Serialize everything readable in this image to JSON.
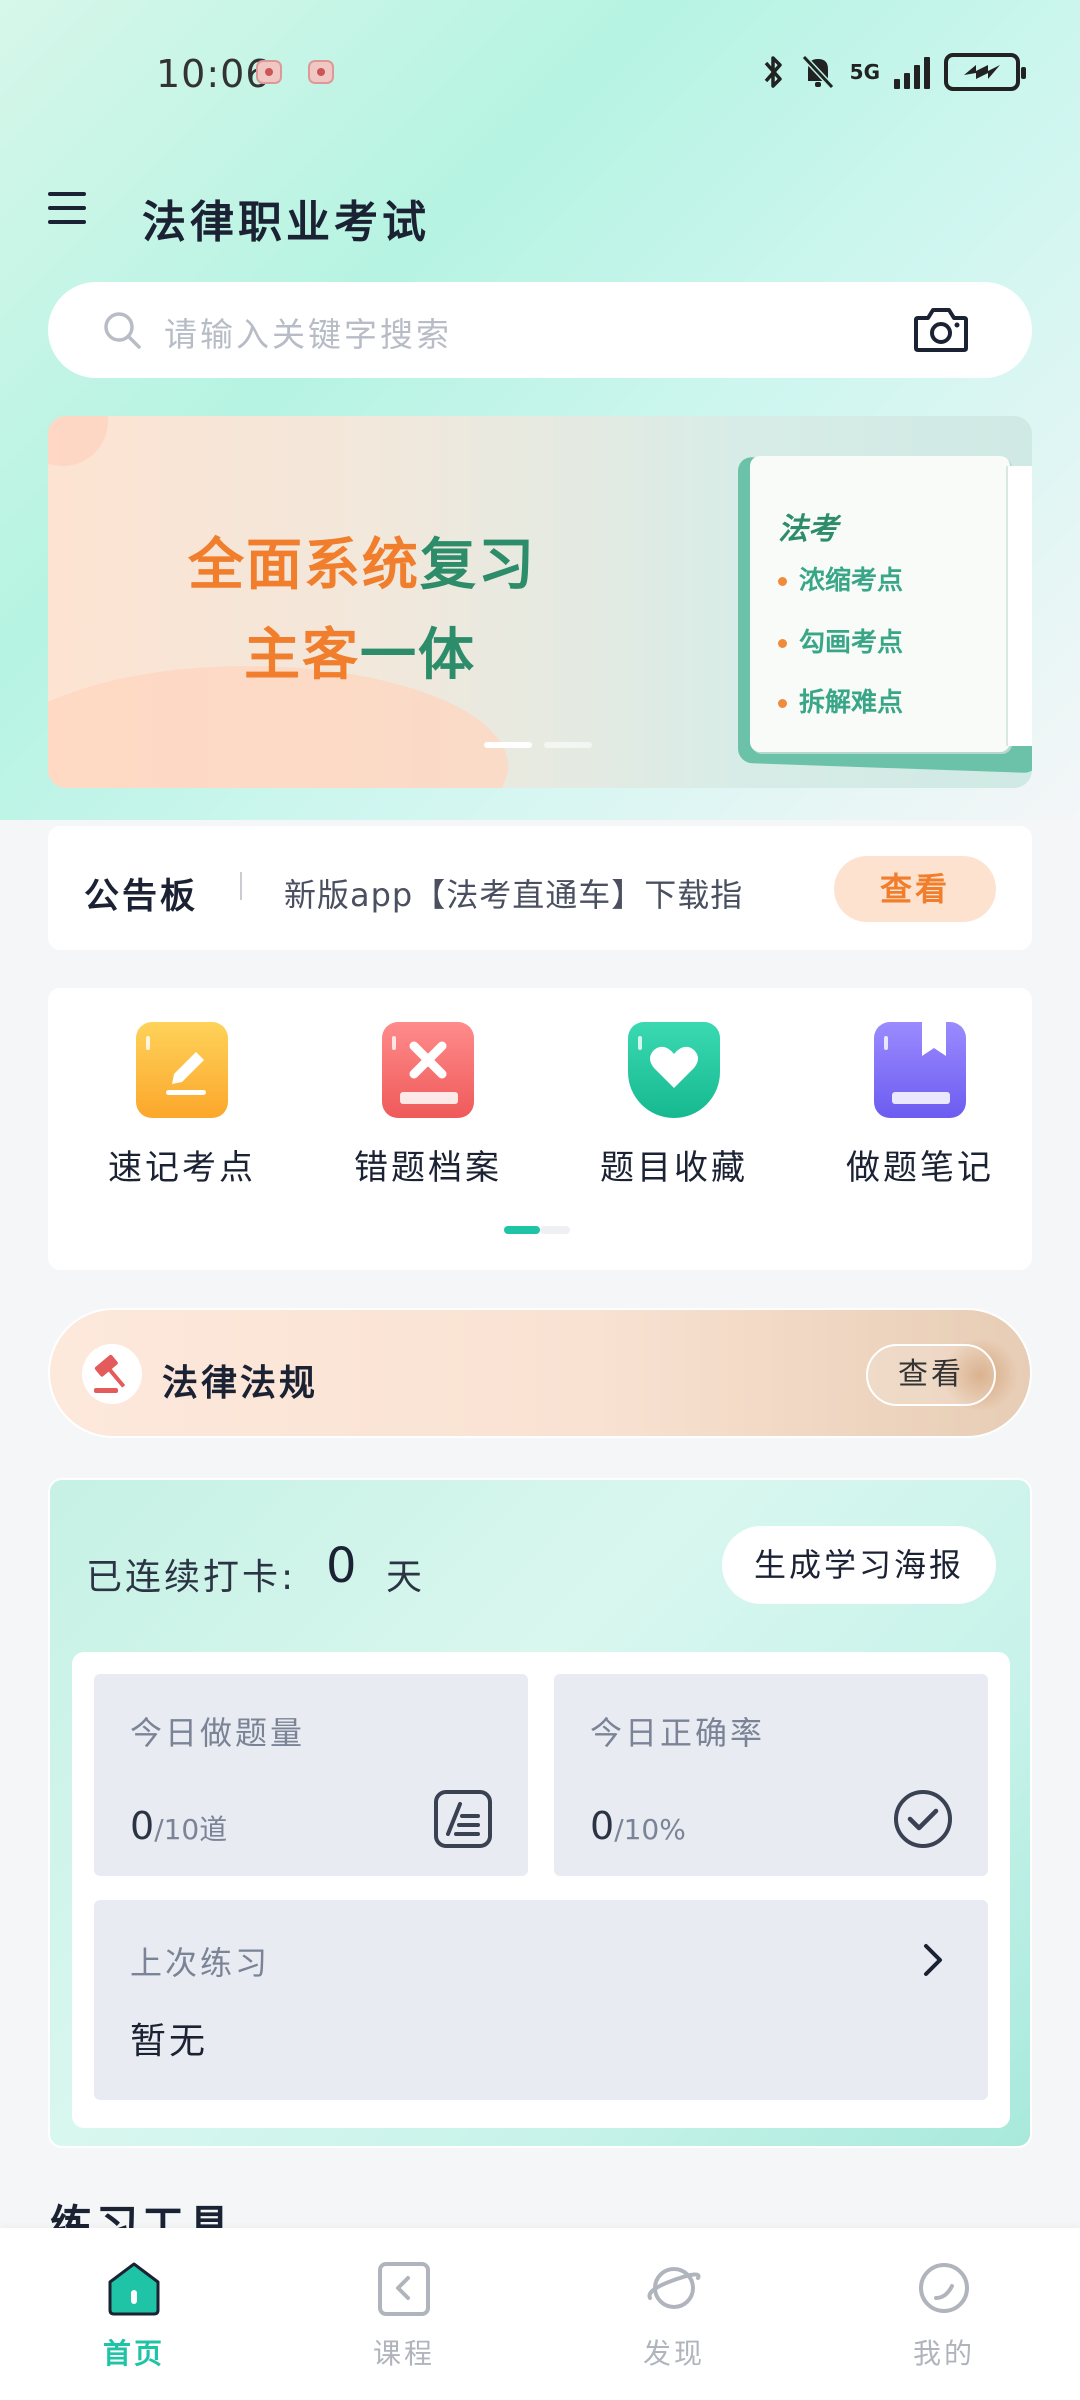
{
  "status_bar": {
    "time": "10:06",
    "network": "5G",
    "battery_icon": "battery-charging-icon"
  },
  "header": {
    "title": "法律职业考试"
  },
  "search": {
    "placeholder": "请输入关键字搜索"
  },
  "banner": {
    "line1_orange": "全面系统",
    "line1_green": "复习",
    "line2_orange": "主客",
    "line2_green": "一体",
    "book_title": "法考",
    "book_items": [
      "浓缩考点",
      "勾画考点",
      "拆解难点"
    ],
    "active_slide": 1,
    "slide_count": 2
  },
  "notice": {
    "title": "公告板",
    "text": "新版app【法考直通车】下载指",
    "button": "查看"
  },
  "tools": {
    "items": [
      {
        "label": "速记考点",
        "icon": "quick-notes-icon",
        "color": "#fbb53c"
      },
      {
        "label": "错题档案",
        "icon": "wrong-questions-icon",
        "color": "#f36a6a"
      },
      {
        "label": "题目收藏",
        "icon": "favorites-heart-icon",
        "color": "#22c9a4"
      },
      {
        "label": "做题笔记",
        "icon": "notes-book-icon",
        "color": "#7d6cf0"
      }
    ]
  },
  "law": {
    "title": "法律法规",
    "button": "查看"
  },
  "checkin": {
    "label": "已连续打卡:",
    "days": "0",
    "unit": "天",
    "poster_button": "生成学习海报",
    "today_count": {
      "title": "今日做题量",
      "value": "0",
      "suffix": "/10道"
    },
    "today_accuracy": {
      "title": "今日正确率",
      "value": "0",
      "suffix": "/10%"
    },
    "last_practice": {
      "title": "上次练习",
      "value": "暂无"
    }
  },
  "section": {
    "title": "练习工具"
  },
  "tabbar": {
    "items": [
      {
        "label": "首页",
        "active": true
      },
      {
        "label": "课程",
        "active": false
      },
      {
        "label": "发现",
        "active": false
      },
      {
        "label": "我的",
        "active": false
      }
    ],
    "accent": "#1fc3a5"
  }
}
